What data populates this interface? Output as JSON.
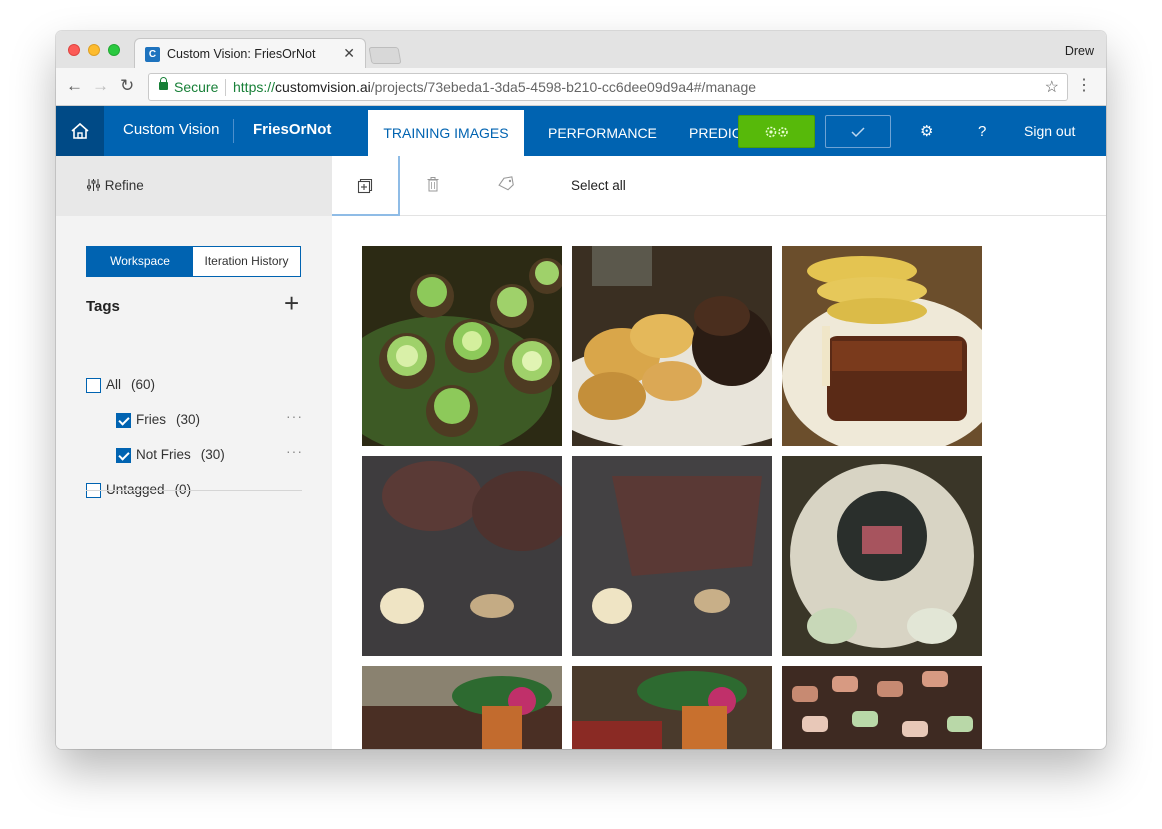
{
  "browser": {
    "tab_title": "Custom Vision: FriesOrNot",
    "tab_close": "✕",
    "profile": "Drew",
    "secure_label": "Secure",
    "url_scheme": "https://",
    "url_host": "customvision.ai",
    "url_path": "/projects/73ebeda1-3da5-4598-b210-cc6dee09d9a4#/manage"
  },
  "app": {
    "brand": "Custom Vision",
    "project": "FriesOrNot",
    "nav": {
      "training_images": "TRAINING IMAGES",
      "performance": "PERFORMANCE",
      "predictions": "PREDICTIONS"
    },
    "sign_out": "Sign out"
  },
  "sidebar": {
    "refine_label": "Refine",
    "toggle": {
      "workspace": "Workspace",
      "iteration_history": "Iteration History"
    },
    "tags_heading": "Tags",
    "tags": [
      {
        "label": "All",
        "count": "(60)",
        "checked": false
      },
      {
        "label": "Fries",
        "count": "(30)",
        "checked": true
      },
      {
        "label": "Not Fries",
        "count": "(30)",
        "checked": true
      },
      {
        "label": "Untagged",
        "count": "(0)",
        "checked": false
      }
    ]
  },
  "toolbar": {
    "select_all": "Select all"
  },
  "colors": {
    "brand_blue": "#0063b1",
    "train_green": "#57b90a"
  }
}
